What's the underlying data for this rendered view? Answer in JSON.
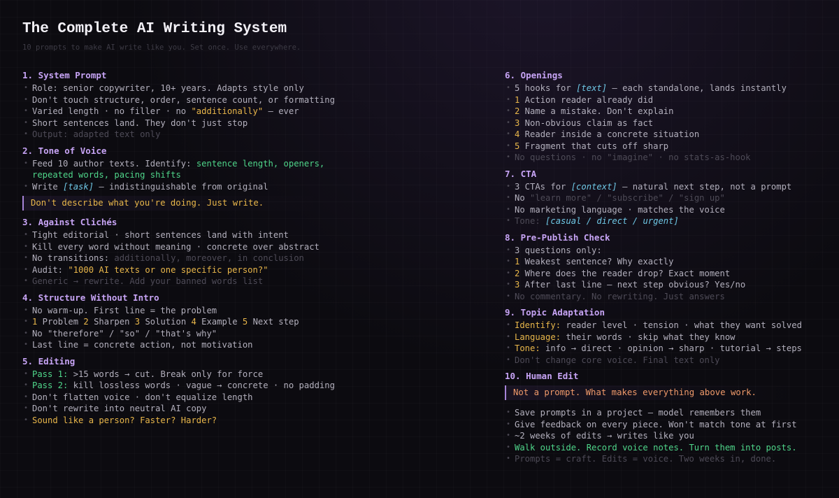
{
  "header": {
    "title": "The Complete AI Writing System",
    "subtitle": "10 prompts to make AI write like you. Set once. Use everywhere."
  },
  "sections": {
    "s1": {
      "title": "1. System Prompt",
      "l1": "Role: senior copywriter, 10+ years. Adapts style only",
      "l2": "Don't touch structure, order, sentence count, or formatting",
      "l3a": "Varied length · no filler · no ",
      "l3b": "\"additionally\"",
      "l3c": " — ever",
      "l4": "Short sentences land. They don't just stop",
      "l5": "Output: adapted text only"
    },
    "s2": {
      "title": "2. Tone of Voice",
      "l1a": "Feed 10 author texts. Identify: ",
      "l1b": "sentence length, openers,",
      "l2": "repeated words, pacing shifts",
      "l3a": "Write ",
      "l3b": "[task]",
      "l3c": " — indistinguishable from original",
      "callout": "Don't describe what you're doing. Just write."
    },
    "s3": {
      "title": "3. Against Clichés",
      "l1": "Tight editorial · short sentences land with intent",
      "l2": "Kill every word without meaning · concrete over abstract",
      "l3a": "No transitions: ",
      "l3b": "additionally, moreover, in conclusion",
      "l4a": "Audit: ",
      "l4b": "\"1000 AI texts or one specific person?\"",
      "l5": "Generic → rewrite. Add your banned words list"
    },
    "s4": {
      "title": "4. Structure Without Intro",
      "l1": "No warm-up. First line = the problem",
      "n1": "1",
      "t1": " Problem ",
      "n2": "2",
      "t2": " Sharpen ",
      "n3": "3",
      "t3": " Solution ",
      "n4": "4",
      "t4": " Example ",
      "n5": "5",
      "t5": " Next step",
      "l3": "No \"therefore\" / \"so\" / \"that's why\"",
      "l4": "Last line = concrete action, not motivation"
    },
    "s5": {
      "title": "5. Editing",
      "l1a": "Pass 1:",
      "l1b": " >15 words → cut. Break only for force",
      "l2a": "Pass 2:",
      "l2b": " kill lossless words · vague → concrete · no padding",
      "l3": "Don't flatten voice · don't equalize length",
      "l4": "Don't rewrite into neutral AI copy",
      "l5": "Sound like a person? Faster? Harder?"
    },
    "s6": {
      "title": "6. Openings",
      "l1a": "5 hooks for ",
      "l1b": "[text]",
      "l1c": " — each standalone, lands instantly",
      "n1": "1",
      "t1": " Action reader already did",
      "n2": "2",
      "t2": " Name a mistake. Don't explain",
      "n3": "3",
      "t3": " Non-obvious claim as fact",
      "n4": "4",
      "t4": " Reader inside a concrete situation",
      "n5": "5",
      "t5": " Fragment that cuts off sharp",
      "l7": "No questions · no \"imagine\" · no stats-as-hook"
    },
    "s7": {
      "title": "7. CTA",
      "l1a": "3 CTAs for ",
      "l1b": "[context]",
      "l1c": " — natural next step, not a prompt",
      "l2a": "No ",
      "l2b": "\"learn more\" / \"subscribe\" / \"sign up\"",
      "l3": "No marketing language · matches the voice",
      "l4a": "Tone: ",
      "l4b": "[casual / direct / urgent]"
    },
    "s8": {
      "title": "8. Pre-Publish Check",
      "l1": "3 questions only:",
      "n1": "1",
      "t1": " Weakest sentence? Why exactly",
      "n2": "2",
      "t2": " Where does the reader drop? Exact moment",
      "n3": "3",
      "t3": " After last line — next step obvious? Yes/no",
      "l5": "No commentary. No rewriting. Just answers"
    },
    "s9": {
      "title": "9. Topic Adaptation",
      "l1a": "Identify:",
      "l1b": " reader level · tension · what they want solved",
      "l2a": "Language:",
      "l2b": " their words · skip what they know",
      "l3a": "Tone:",
      "l3b": " info → direct · opinion → sharp · tutorial → steps",
      "l4": "Don't change core voice. Final text only"
    },
    "s10": {
      "title": "10. Human Edit",
      "callout": "Not a prompt. What makes everything above work.",
      "l1": "Save prompts in a project — model remembers them",
      "l2": "Give feedback on every piece. Won't match tone at first",
      "l3": "~2 weeks of edits → writes like you",
      "l4": "Walk outside. Record voice notes. Turn them into posts.",
      "l5": "Prompts = craft. Edits = voice. Two weeks in, done."
    }
  },
  "bullet": "•",
  "colors": {
    "heading": "#c7a4f5",
    "highlight_yellow": "#e8b64a",
    "highlight_green": "#4fd68a",
    "highlight_cyan": "#6fc8e6",
    "callout_orange": "#f09a6a",
    "background": "#0c0b10"
  }
}
